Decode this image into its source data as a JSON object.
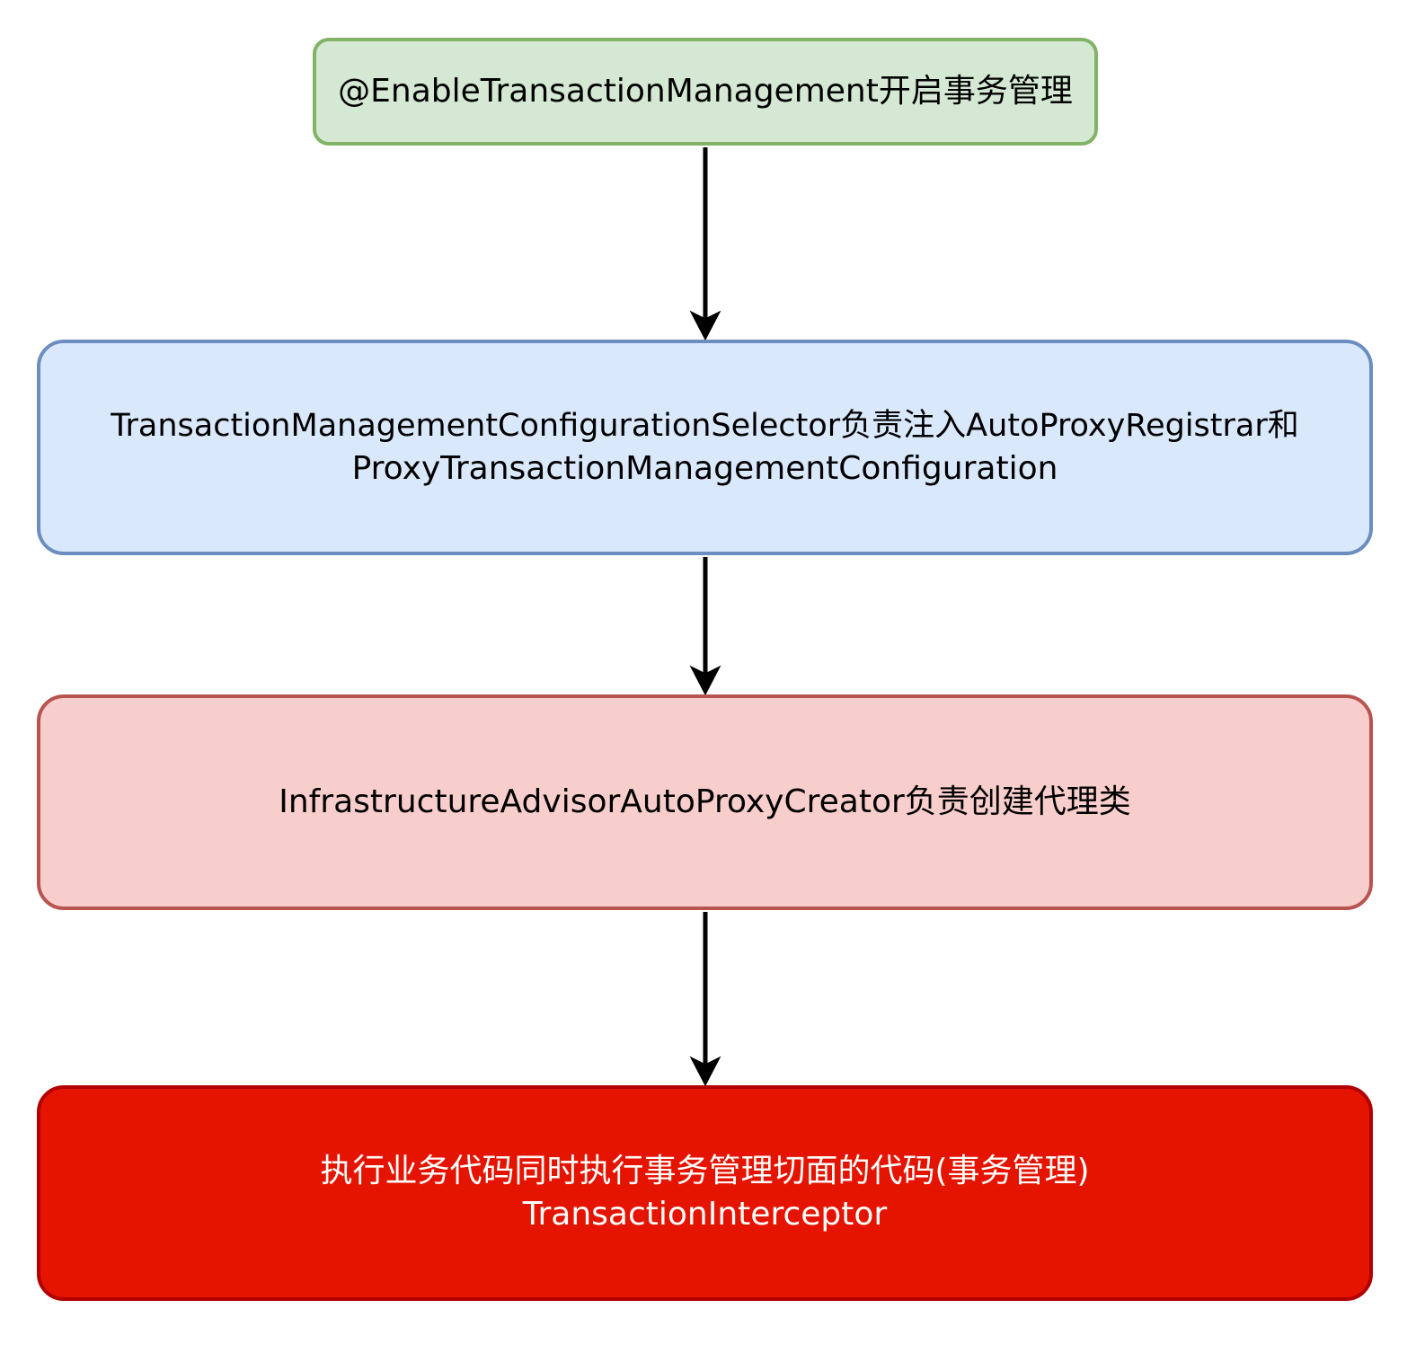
{
  "nodes": {
    "enable": {
      "text": "@EnableTransactionManagement开启事务管理",
      "fill": "#d5e8d4",
      "stroke": "#82b366"
    },
    "selector": {
      "line1": "TransactionManagementConfigurationSelector负责注入AutoProxyRegistrar和",
      "line2": "ProxyTransactionManagementConfiguration",
      "fill": "#dae8fc",
      "stroke": "#6c8ebf"
    },
    "creator": {
      "text": "InfrastructureAdvisorAutoProxyCreator负责创建代理类",
      "fill": "#f8cecc",
      "stroke": "#b85450"
    },
    "interceptor": {
      "line1": "执行业务代码同时执行事务管理切面的代码(事务管理)",
      "line2": "TransactionInterceptor",
      "fill": "#e51400",
      "stroke": "#b20000",
      "text_color": "#ffffff"
    }
  },
  "edges": [
    {
      "from": "enable",
      "to": "selector"
    },
    {
      "from": "selector",
      "to": "creator"
    },
    {
      "from": "creator",
      "to": "interceptor"
    }
  ]
}
